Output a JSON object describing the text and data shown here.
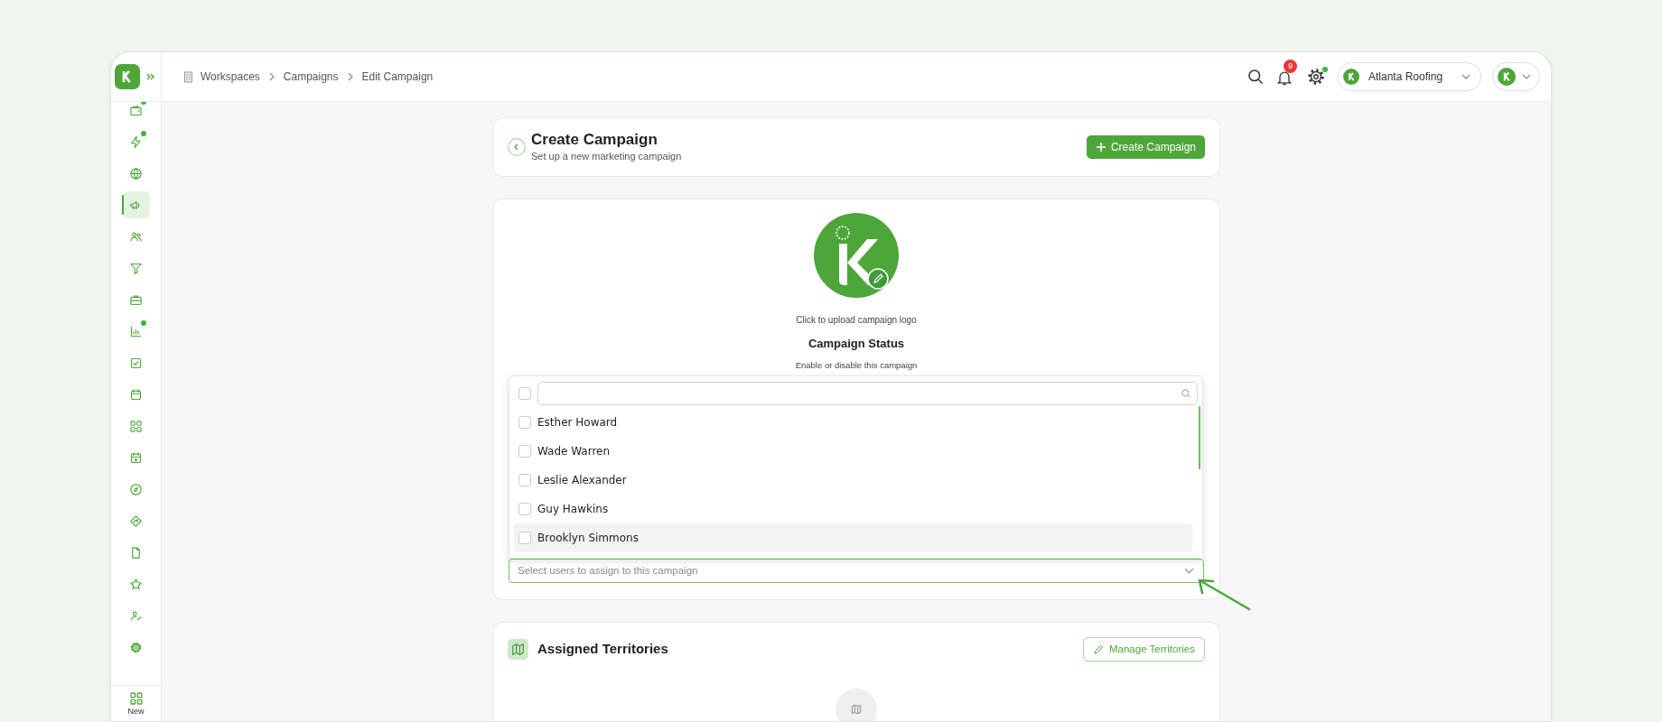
{
  "breadcrumbs": [
    "Workspaces",
    "Campaigns",
    "Edit Campaign"
  ],
  "topbar": {
    "notification_count": "9",
    "settings_dot": true,
    "workspace": "Atlanta Roofing"
  },
  "sidebar": {
    "items": [
      {
        "kind": "wallet",
        "selected": false,
        "dot": true
      },
      {
        "kind": "zap",
        "selected": false,
        "dot": true
      },
      {
        "kind": "globe",
        "selected": false,
        "dot": false
      },
      {
        "kind": "megaphone",
        "selected": true,
        "dot": false
      },
      {
        "kind": "users",
        "selected": false,
        "dot": false
      },
      {
        "kind": "filter",
        "selected": false,
        "dot": false
      },
      {
        "kind": "briefcase",
        "selected": false,
        "dot": false
      },
      {
        "kind": "chart",
        "selected": false,
        "dot": true
      },
      {
        "kind": "check-square",
        "selected": false,
        "dot": false
      },
      {
        "kind": "calendar",
        "selected": false,
        "dot": false
      },
      {
        "kind": "grid",
        "selected": false,
        "dot": false
      },
      {
        "kind": "calendar-plus",
        "selected": false,
        "dot": false
      },
      {
        "kind": "compass",
        "selected": false,
        "dot": false
      },
      {
        "kind": "directions",
        "selected": false,
        "dot": false
      },
      {
        "kind": "file",
        "selected": false,
        "dot": false
      },
      {
        "kind": "star",
        "selected": false,
        "dot": false
      },
      {
        "kind": "user-pen",
        "selected": false,
        "dot": false
      },
      {
        "kind": "settings",
        "selected": false,
        "dot": false
      }
    ],
    "footer_label": "New"
  },
  "header": {
    "title": "Create Campaign",
    "subtitle": "Set up a new marketing campaign",
    "create_button": "Create Campaign"
  },
  "logo_upload": {
    "hint": "Click to upload campaign logo"
  },
  "status": {
    "title": "Campaign Status",
    "subtitle": "Enable or disable this campaign"
  },
  "user_picker": {
    "select_all_checked": false,
    "options": [
      {
        "label": "Esther Howard",
        "checked": false,
        "highlighted": false
      },
      {
        "label": "Wade Warren",
        "checked": false,
        "highlighted": false
      },
      {
        "label": "Leslie Alexander",
        "checked": false,
        "highlighted": false
      },
      {
        "label": "Guy Hawkins",
        "checked": false,
        "highlighted": false
      },
      {
        "label": "Brooklyn Simmons",
        "checked": false,
        "highlighted": true
      }
    ],
    "placeholder": "Select users to assign to this campaign"
  },
  "territories": {
    "title": "Assigned Territories",
    "button": "Manage Territories"
  }
}
